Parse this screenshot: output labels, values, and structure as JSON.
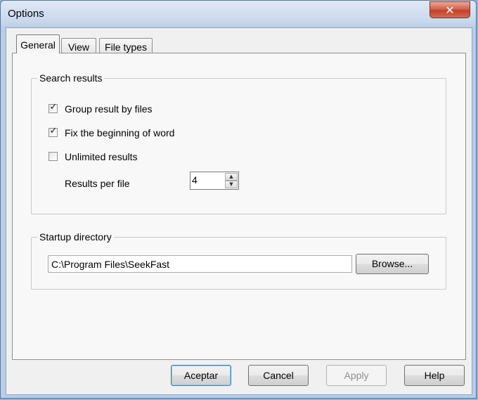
{
  "window": {
    "title": "Options",
    "close_icon": "close-icon"
  },
  "tabs": [
    {
      "label": "General",
      "active": true
    },
    {
      "label": "View",
      "active": false
    },
    {
      "label": "File types",
      "active": false
    }
  ],
  "search_results": {
    "legend": "Search results",
    "group_by_files": {
      "label": "Group result by files",
      "checked": true
    },
    "fix_beginning": {
      "label": "Fix the beginning of word",
      "checked": true
    },
    "unlimited": {
      "label": "Unlimited results",
      "checked": false
    },
    "results_per_file": {
      "label": "Results per file",
      "value": "4"
    }
  },
  "startup_directory": {
    "legend": "Startup directory",
    "path": "C:\\Program Files\\SeekFast",
    "browse_label": "Browse..."
  },
  "buttons": {
    "ok": "Aceptar",
    "cancel": "Cancel",
    "apply": "Apply",
    "help": "Help"
  }
}
